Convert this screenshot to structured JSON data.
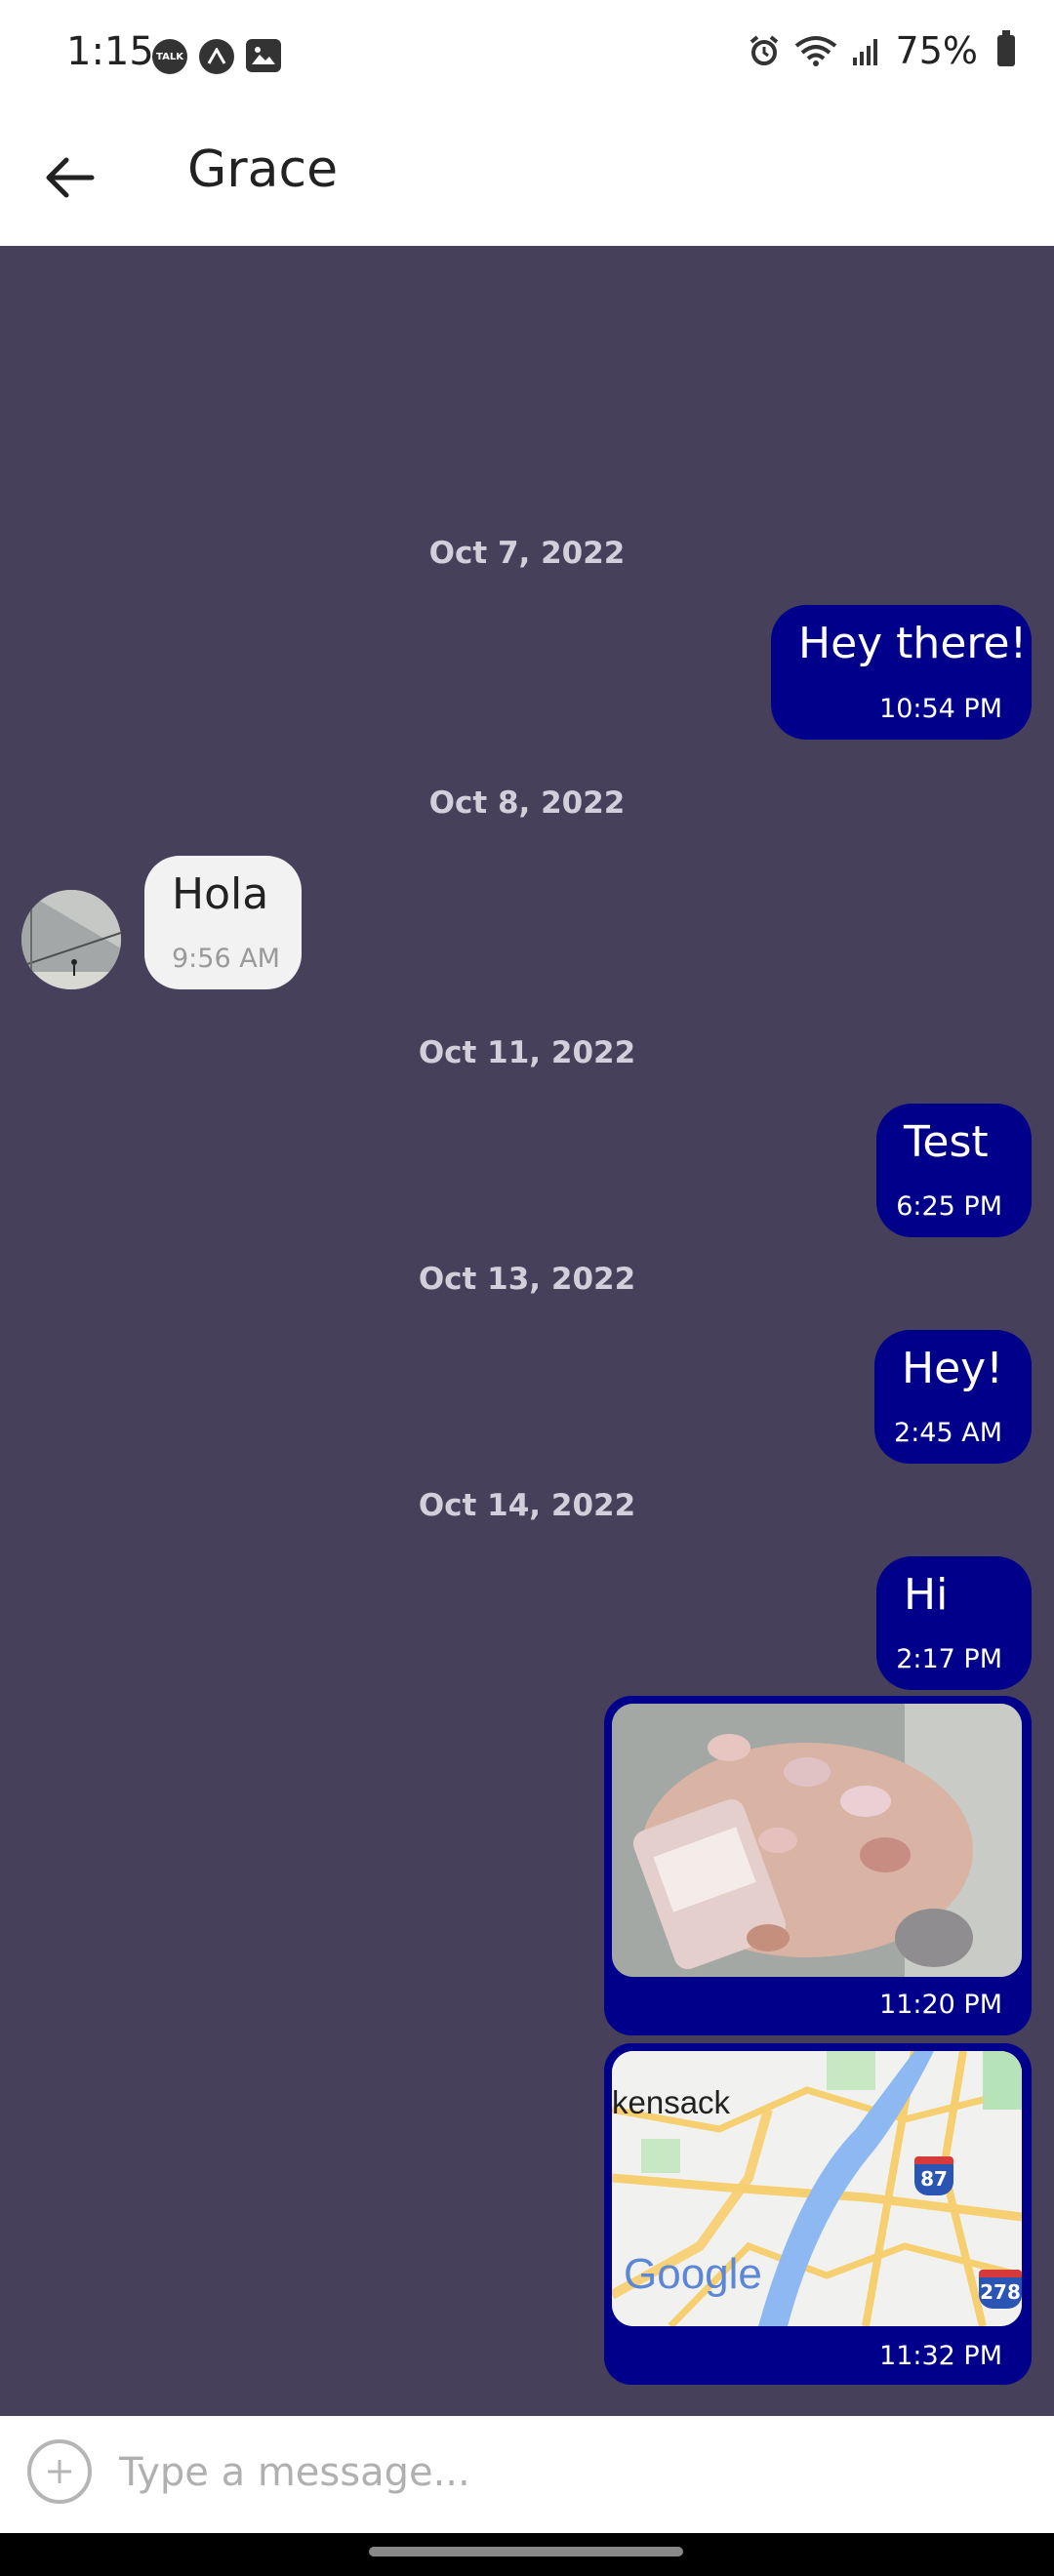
{
  "status_bar": {
    "time": "1:15",
    "talk_icon_text": "TALK",
    "battery": "75%"
  },
  "header": {
    "title": "Grace"
  },
  "conversation": {
    "dates": [
      "Oct 7, 2022",
      "Oct 8, 2022",
      "Oct 11, 2022",
      "Oct 13, 2022",
      "Oct 14, 2022"
    ],
    "messages": [
      {
        "direction": "outgoing",
        "text": "Hey there!",
        "time": "10:54 PM"
      },
      {
        "direction": "incoming",
        "text": "Hola",
        "time": "9:56 AM"
      },
      {
        "direction": "outgoing",
        "text": "Test",
        "time": "6:25 PM"
      },
      {
        "direction": "outgoing",
        "text": "Hey!",
        "time": "2:45 AM"
      },
      {
        "direction": "outgoing",
        "text": "Hi",
        "time": "2:17 PM"
      },
      {
        "direction": "outgoing",
        "type": "image",
        "time": "11:20 PM"
      },
      {
        "direction": "outgoing",
        "type": "map",
        "time": "11:32 PM",
        "map_label": "kensack",
        "map_logo": "Google",
        "shield_1": "87",
        "shield_2": "278"
      }
    ]
  },
  "composer": {
    "placeholder": "Type a message..."
  },
  "colors": {
    "chat_background": "#46405a",
    "outgoing_bubble": "#00008b",
    "incoming_bubble": "#f2f2f2"
  }
}
